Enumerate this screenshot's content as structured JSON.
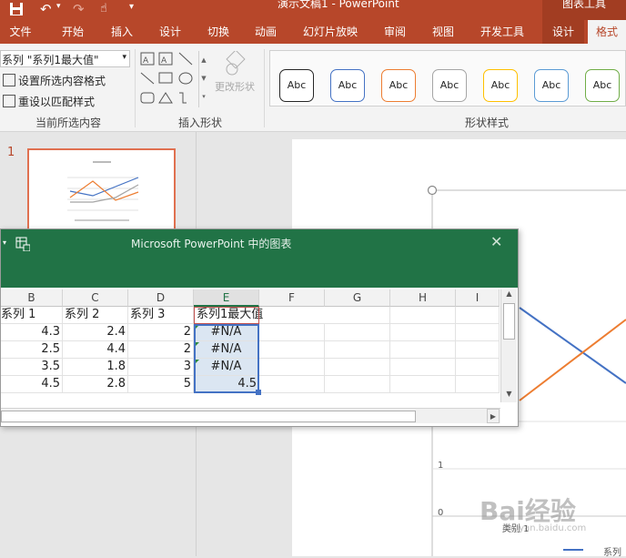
{
  "titlebar": {
    "doc_title": "演示文稿1 - PowerPoint",
    "context_tool": "图表工具"
  },
  "tabs": [
    "文件",
    "开始",
    "插入",
    "设计",
    "切换",
    "动画",
    "幻灯片放映",
    "审阅",
    "视图",
    "开发工具",
    "设计",
    "格式"
  ],
  "ribbon": {
    "current_selection": {
      "dropdown_value": "系列 \"系列1最大值\"",
      "format_selection": "设置所选内容格式",
      "reset_style": "重设以匹配样式",
      "group_label": "当前所选内容"
    },
    "insert_shapes": {
      "change_shape": "更改形状",
      "group_label": "插入形状"
    },
    "shape_styles": {
      "group_label": "形状样式",
      "box_text": "Abc",
      "border_colors": [
        "#262626",
        "#4472c4",
        "#ed7d31",
        "#a5a5a5",
        "#ffc000",
        "#5b9bd5",
        "#70ad47"
      ]
    }
  },
  "slide_number": "1",
  "sheet": {
    "window_title": "Microsoft PowerPoint 中的图表",
    "columns": [
      "B",
      "C",
      "D",
      "E",
      "F",
      "G",
      "H",
      "I"
    ],
    "header_row": [
      "系列 1",
      "系列 2",
      "系列 3",
      "系列1最大值"
    ],
    "rows": [
      [
        "4.3",
        "2.4",
        "2",
        "#N/A"
      ],
      [
        "2.5",
        "4.4",
        "2",
        "#N/A"
      ],
      [
        "3.5",
        "1.8",
        "3",
        "#N/A"
      ],
      [
        "4.5",
        "2.8",
        "5",
        "4.5"
      ]
    ]
  },
  "chart": {
    "y_ticks": [
      "1",
      "0"
    ],
    "x_label": "类别 1",
    "legend_label": "系列",
    "series_colors": {
      "series1": "#4472c4",
      "series2": "#ed7d31"
    }
  },
  "watermark": {
    "text": "Bai经验",
    "url": "jingyan.baidu.com"
  }
}
